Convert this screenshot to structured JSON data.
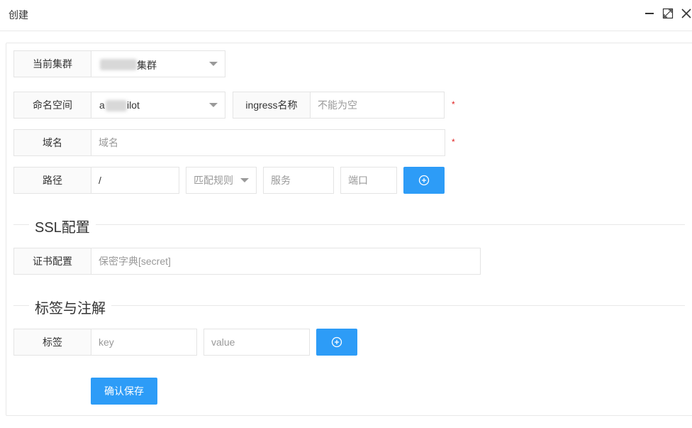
{
  "window": {
    "title": "创建",
    "icons": [
      "minimize-icon",
      "maximize-icon",
      "close-icon"
    ]
  },
  "form": {
    "cluster": {
      "label": "当前集群",
      "value": "集群"
    },
    "namespace": {
      "label": "命名空间",
      "value_prefix": "a",
      "value_suffix": "ilot"
    },
    "ingress_name": {
      "label": "ingress名称",
      "placeholder": "不能为空",
      "required_mark": "*"
    },
    "domain": {
      "label": "域名",
      "placeholder": "域名",
      "required_mark": "*"
    },
    "path": {
      "label": "路径",
      "value": "/",
      "match_rule_placeholder": "匹配规则",
      "service_placeholder": "服务",
      "port_placeholder": "端口"
    }
  },
  "ssl": {
    "section_title": "SSL配置",
    "cert_label": "证书配置",
    "cert_placeholder": "保密字典[secret]"
  },
  "labels_section": {
    "section_title": "标签与注解",
    "label": "标签",
    "key_placeholder": "key",
    "value_placeholder": "value"
  },
  "actions": {
    "save_label": "确认保存"
  },
  "colors": {
    "primary": "#2d9cf7",
    "required": "#e02020",
    "border": "#e4e4e4",
    "label_bg": "#fafafa"
  }
}
